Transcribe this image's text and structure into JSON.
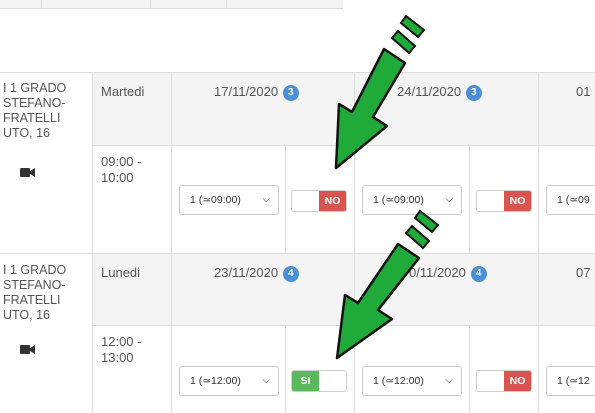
{
  "colors": {
    "badge": "#4a90d9",
    "no": "#d9534f",
    "si": "#5cb85c",
    "arrow": "#1faa3a"
  },
  "rows": [
    {
      "school": "I 1 GRADO\nSTEFANO-\nFRATELLI\nUTO, 16",
      "day": "Martedi",
      "time": "09:00 -\n10:00",
      "dates": [
        {
          "date": "17/11/2020",
          "badge": "3"
        },
        {
          "date": "24/11/2020",
          "badge": "3"
        },
        {
          "date": "01",
          "badge": ""
        }
      ],
      "cells": [
        {
          "select": "1 (≃09:00)",
          "toggle": "NO"
        },
        {
          "select": "1 (≃09:00)",
          "toggle": "NO"
        },
        {
          "select": "1 (≃09",
          "toggle": ""
        }
      ]
    },
    {
      "school": "I 1 GRADO\nSTEFANO-\nFRATELLI\nUTO, 16",
      "day": "Lunedi",
      "time": "12:00 -\n13:00",
      "dates": [
        {
          "date": "23/11/2020",
          "badge": "4"
        },
        {
          "date": "0/11/2020",
          "badge": "4"
        },
        {
          "date": "07",
          "badge": ""
        }
      ],
      "cells": [
        {
          "select": "1 (≃12:00)",
          "toggle": "SI"
        },
        {
          "select": "1 (≃12:00)",
          "toggle": "NO"
        },
        {
          "select": "1 (≃12",
          "toggle": ""
        }
      ]
    }
  ]
}
